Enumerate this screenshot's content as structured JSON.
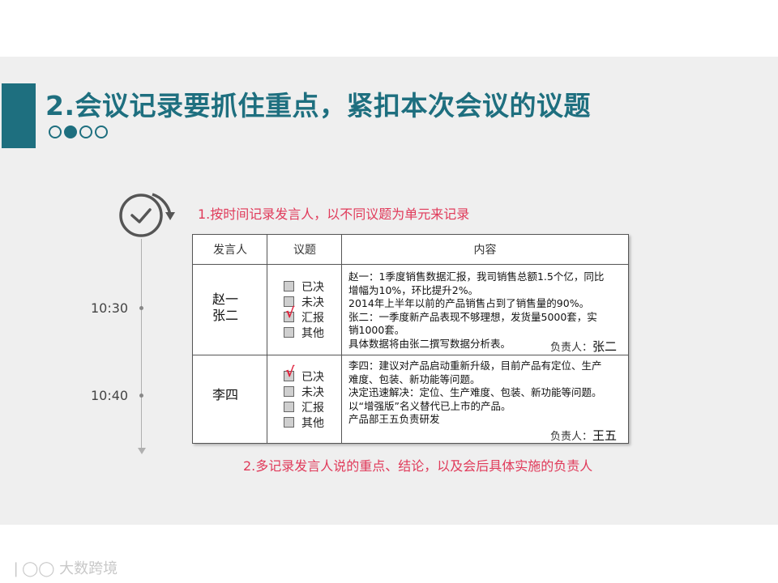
{
  "title": "2.会议记录要抓住重点，紧扣本次会议的议题",
  "note_top": "1.按时间记录发言人，以不同议题为单元来记录",
  "note_bottom": "2.多记录发言人说的重点、结论，以及会后具体实施的负责人",
  "timeline": {
    "times": [
      "10:30",
      "10:40"
    ]
  },
  "table": {
    "headers": [
      "发言人",
      "议题",
      "内容"
    ],
    "rows": [
      {
        "speaker_line1": "赵一",
        "speaker_line2": "张二",
        "options": [
          "已决",
          "未决",
          "汇报",
          "其他"
        ],
        "checked": "汇报",
        "content": [
          "赵一：1季度销售数据汇报，我司销售总额1.5个亿，同比",
          "增幅为10%，环比提升2%。",
          "2014年上半年以前的产品销售占到了销售量的90%。",
          "张二：一季度新产品表现不够理想，发货量5000套，实",
          "销1000套。",
          "具体数据将由张二撰写数据分析表。"
        ],
        "owner_label": "负责人：",
        "owner_name": "张二"
      },
      {
        "speaker_line1": "李四",
        "options": [
          "已决",
          "未决",
          "汇报",
          "其他"
        ],
        "checked": "已决",
        "content": [
          "李四：建议对产品启动重新升级，目前产品有定位、生产",
          "难度、包装、新功能等问题。",
          "决定迅速解决：定位、生产难度、包装、新功能等问题。",
          "以“增强版”名义替代已上市的产品。",
          "产品部王五负责研发"
        ],
        "owner_label": "负责人：",
        "owner_name": "王五"
      }
    ]
  },
  "watermark": "大数跨境",
  "colors": {
    "accent": "#1e6f7f",
    "note": "#e03a5a",
    "check": "#e0203a"
  }
}
